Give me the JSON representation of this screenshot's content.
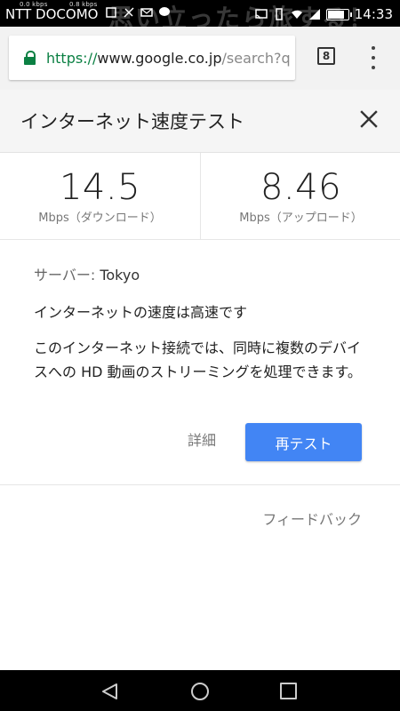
{
  "status_bar": {
    "speed_down": "0.0 kbps",
    "speed_up": "0.8 kbps",
    "carrier": "NTT DOCOMO",
    "overlay_text": "思い立ったら旅する！",
    "time": "14:33",
    "battery_level": 0.85
  },
  "browser": {
    "url_scheme": "https://",
    "url_host": "www.google.co.jp",
    "url_path": "/search?q",
    "tab_count": "8"
  },
  "card": {
    "title": "インターネット速度テスト",
    "download": {
      "value": "14.5",
      "label": "Mbps（ダウンロード）"
    },
    "upload": {
      "value": "8.46",
      "label": "Mbps（アップロード）"
    },
    "server_label": "サーバー: ",
    "server_value": "Tokyo",
    "verdict": "インターネットの速度は高速です",
    "description": "このインターネット接続では、同時に複数のデバイスへの HD 動画のストリーミングを処理できます。",
    "details_label": "詳細",
    "retest_label": "再テスト",
    "feedback_label": "フィードバック"
  },
  "colors": {
    "accent": "#4285f4",
    "secure": "#0b8043"
  }
}
